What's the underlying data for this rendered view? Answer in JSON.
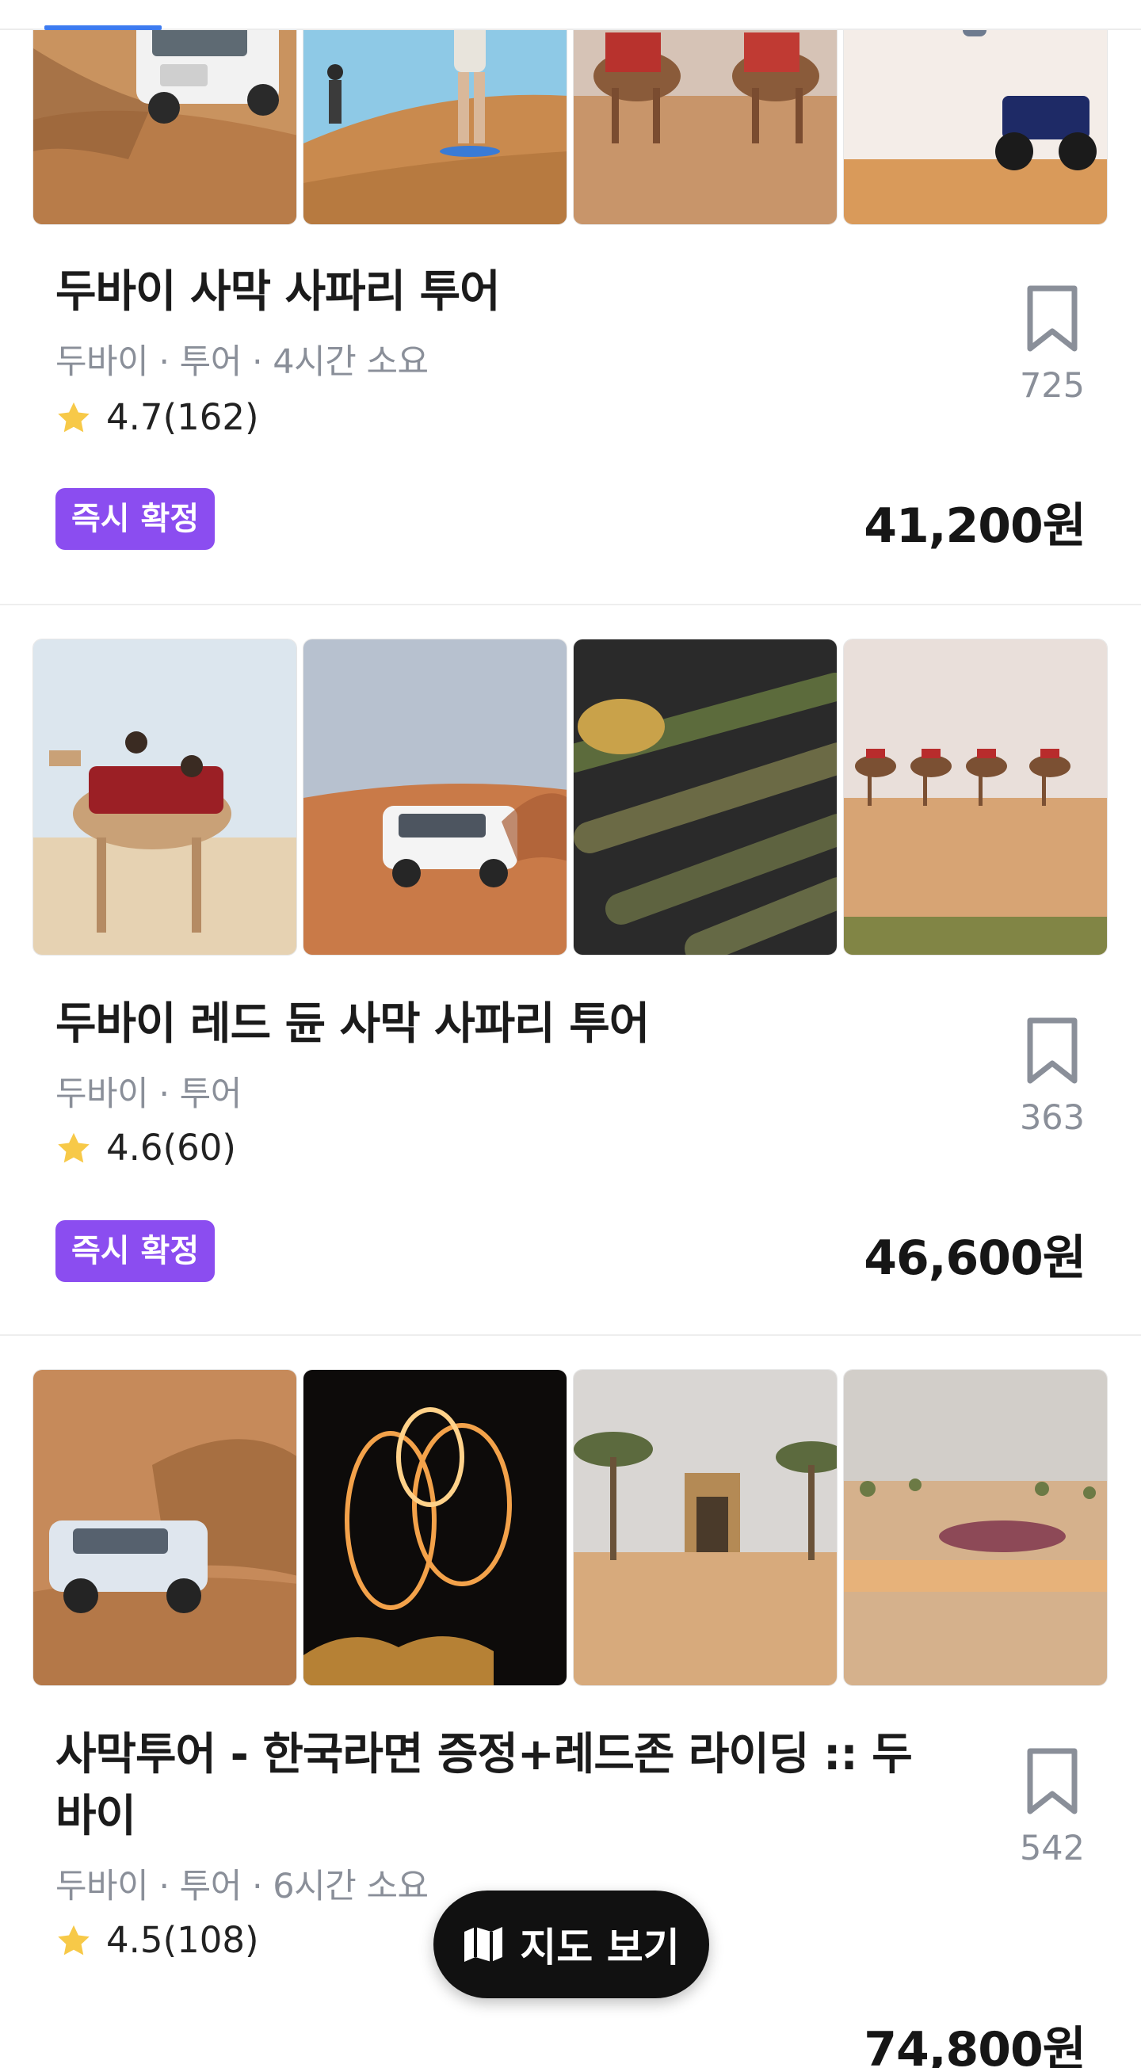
{
  "products": [
    {
      "title": "두바이 사막 사파리 투어",
      "meta": "두바이 · 투어 · 4시간 소요",
      "rating": "4.7",
      "reviews": "(162)",
      "badge": "즉시 확정",
      "price": "41,200원",
      "bookmarks": "725",
      "photos": [
        "desert-jeep-photo",
        "sandboarding-photo",
        "camel-ride-photo",
        "quad-bike-photo"
      ]
    },
    {
      "title": "두바이 레드 듄 사막 사파리 투어",
      "meta": "두바이 · 투어",
      "rating": "4.6",
      "reviews": "(60)",
      "badge": "즉시 확정",
      "price": "46,600원",
      "bookmarks": "363",
      "photos": [
        "camel-riders-photo",
        "suv-dune-photo",
        "kebab-grill-photo",
        "camel-caravan-photo"
      ]
    },
    {
      "title": "사막투어 - 한국라면 증정+레드존 라이딩 :: 두바이",
      "meta": "두바이 · 투어 · 6시간 소요",
      "rating": "4.5",
      "reviews": "(108)",
      "badge": "",
      "price": "74,800원",
      "bookmarks": "542",
      "photos": [
        "dune-bashing-photo",
        "fire-show-photo",
        "desert-camp-gate-photo",
        "camp-aerial-photo"
      ]
    }
  ],
  "map_button": {
    "label": "지도 보기",
    "icon": "map-icon"
  },
  "colors": {
    "badge": "#8b4df0",
    "star": "#f7c948",
    "price": "#161616",
    "muted": "#8a8f99",
    "map_button": "#111111",
    "tab_indicator": "#3d7bf0"
  }
}
